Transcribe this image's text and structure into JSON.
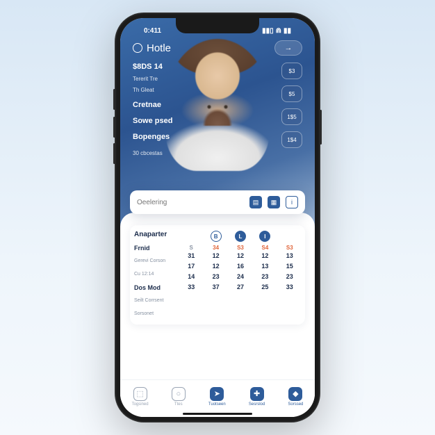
{
  "status": {
    "time": "0:411",
    "signal": "▮▮▯",
    "wifi": "⋒",
    "battery": "▮▮"
  },
  "header": {
    "title": "Hotle",
    "arrow": "→"
  },
  "menu": {
    "stat": "$8DS 14",
    "sub1": "Tererit Tre",
    "sub2": "Th Gleat",
    "items": [
      "Cretnae",
      "Sowe psed",
      "Bopenges"
    ],
    "footer": "30 cbcestas"
  },
  "pills": [
    "$3",
    "$5",
    "1$5",
    "1$4"
  ],
  "search": {
    "placeholder": "Oeelering",
    "icons": [
      "doc-icon",
      "calendar-icon",
      "info-icon"
    ]
  },
  "calendar": {
    "title": "Anaparter",
    "sideRows": [
      "Frnid",
      "Gerevi Corson",
      "Cu 12:14",
      "Dos Mod",
      "Seilt Corrsent",
      "Sorsonet"
    ],
    "topDots": [
      "B",
      "L",
      "I"
    ],
    "heads": [
      "S",
      "34",
      "S3",
      "S4",
      "S3"
    ],
    "rows": [
      [
        "31",
        "12",
        "12",
        "12",
        "13"
      ],
      [
        "17",
        "12",
        "16",
        "13",
        "15"
      ],
      [
        "14",
        "23",
        "24",
        "23",
        "23"
      ],
      [
        "33",
        "37",
        "27",
        "25",
        "33"
      ]
    ]
  },
  "tabs": [
    {
      "label": "Togsined",
      "icon": "⬚"
    },
    {
      "label": "Ttes",
      "icon": "○"
    },
    {
      "label": "Tuotseen",
      "icon": "➤"
    },
    {
      "label": "Sesrslod",
      "icon": "✚"
    },
    {
      "label": "Sorssed",
      "icon": "◆"
    }
  ]
}
